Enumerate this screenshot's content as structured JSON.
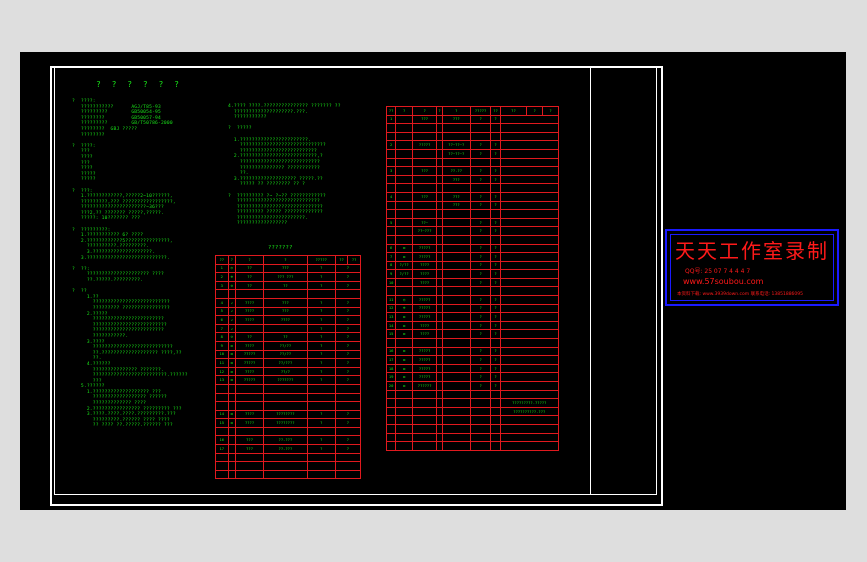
{
  "drawing": {
    "heading": "? ? ? ? ? ?",
    "col1_lines": [
      "?  ????:",
      "   ???????????      AGJ/T85-93",
      "   ?????????        GB50054-95",
      "   ????????         GB50057-94",
      "   ?????????        GB/T50786-2000",
      "   ????????  GBJ ?????",
      "   ????????",
      "",
      "?  ????:",
      "   ???",
      "   ????",
      "   ???",
      "   ????",
      "   ?????",
      "   ?????",
      "",
      "?  ???:",
      "   1.????????????,?????2~10??????,",
      "   ?????????,??? ?????????????????,",
      "   ??????????????????????~36???",
      "   ???2,?? ??????? ?????,?????.",
      "   ?????: 10??????? ???",
      "",
      "?  ?????????:",
      "   1.??????????? 6? ????",
      "   2.????????????5???????????????,",
      "     ??????????.?????????.",
      "     3.????????????????????.",
      "   3.???????????????????????????.",
      "",
      "?  ??:",
      "     ????????????????????? ????",
      "     ??.?????.?????????.",
      "",
      "?  ??",
      "     1.??",
      "       ??????????????????????????",
      "       ????????? ????????????????",
      "     2.?????",
      "       ????????????????????????",
      "       ?????????????????????????",
      "       ????????????????????????",
      "       ???????????.",
      "     3.????",
      "       ???????????????????????????",
      "       ??.??????????????????? ????,??",
      "       ??.",
      "     4.??????",
      "       ??????????????? ???????.",
      "       ?????????????????????????.??????",
      "       ???",
      "   5.??????",
      "     1.??????????????????? ???",
      "       ?????????????????? ??????",
      "       ????????????? ????",
      "     2.???????????????? ????????? ???",
      "     3.????.????.????.?????????.???",
      "       ?????????.?????? ???? ????",
      "       ?? ???? ??.?????.?????? ???"
    ],
    "col2_lines": [
      "4.???? ????.??????????????? ??????? ??",
      "  ????????????????????.???.",
      "  ???????????",
      "",
      "?  ?????",
      "",
      "  1.???????????????????????.",
      "    ?????????????????????????????",
      "    ??????????????????????????",
      "  2.??????????????????????????,?",
      "    ???????????????????????????",
      "    ??????????????? ???????????",
      "    ??.",
      "  3.??????????????????? ?????.??",
      "    ????? ?? ???????? ?? ?",
      "",
      "?  ????????? ?~ ?~?? ????????????",
      "   ????????????????????????????",
      "   ?????????????????????????????",
      "   ????????? ????? ?????????????",
      "   ???????????????????????.",
      "   ?????????????????"
    ],
    "table_a": {
      "title": "???????",
      "header": [
        "??",
        "?",
        "?",
        "?",
        "?????",
        "??",
        "??"
      ],
      "rows": [
        [
          "1",
          "◎",
          "??",
          "???",
          "?",
          "?"
        ],
        [
          "2",
          "⊕",
          "??",
          "??? ???",
          "?",
          "?"
        ],
        [
          "3",
          "⊗",
          "??",
          "??",
          "?",
          "?"
        ],
        [
          "",
          "",
          "",
          "",
          "",
          ""
        ],
        [
          "4",
          "↗",
          "????",
          "???",
          "?",
          "?"
        ],
        [
          "5",
          "↗",
          "????",
          "???",
          "?",
          "?"
        ],
        [
          "6",
          "↗",
          "????",
          "????",
          "?",
          "?"
        ],
        [
          "7",
          "↗",
          "",
          "",
          "?",
          "?"
        ],
        [
          "8",
          "⊘",
          "??",
          "??",
          "?",
          "?"
        ],
        [
          "9",
          "▬",
          "????",
          "??/??",
          "?",
          "?"
        ],
        [
          "10",
          "▬",
          "?????",
          "??/??",
          "?",
          "?"
        ],
        [
          "11",
          "▬",
          "?????",
          "??/???",
          "?",
          "?"
        ],
        [
          "12",
          "▬",
          "????",
          "??/?",
          "?",
          "?"
        ],
        [
          "13",
          "▬",
          "?????",
          "???????",
          "?",
          "?"
        ],
        [
          "",
          "",
          "",
          "",
          "",
          ""
        ],
        [
          "",
          "",
          "",
          "",
          "",
          ""
        ],
        [
          "",
          "",
          "",
          "",
          "",
          ""
        ],
        [
          "14",
          "▬",
          "????",
          "????????",
          "?",
          "?"
        ],
        [
          "15",
          "▬",
          "????",
          "????????",
          "?",
          "?"
        ],
        [
          "",
          "",
          "",
          "",
          "",
          ""
        ],
        [
          "16",
          "",
          "???",
          "??-???",
          "?",
          "?"
        ],
        [
          "17",
          "",
          "???",
          "??-???",
          "?",
          "?"
        ],
        [
          "",
          "",
          "",
          "",
          "",
          ""
        ],
        [
          "",
          "",
          "",
          "",
          "",
          ""
        ],
        [
          "",
          "",
          "",
          "",
          "",
          ""
        ]
      ]
    },
    "table_b": {
      "header": [
        "??",
        "?",
        "?",
        "?",
        "?",
        "?????",
        "??",
        "??",
        "?",
        "?"
      ],
      "rows": [
        [
          "1",
          "",
          "???",
          "",
          "???",
          "?",
          "?",
          ""
        ],
        [
          "",
          "",
          "",
          "",
          "",
          "",
          "",
          ""
        ],
        [
          "",
          "",
          "",
          "",
          "",
          "",
          "",
          ""
        ],
        [
          "2",
          "",
          "?????",
          "",
          "??~??~?",
          "?",
          "?",
          ""
        ],
        [
          "",
          "",
          "",
          "",
          "??~??~?",
          "?",
          "?",
          ""
        ],
        [
          "",
          "",
          "",
          "",
          "",
          "",
          "",
          ""
        ],
        [
          "3",
          "",
          "???",
          "",
          "??.??",
          "?",
          "?",
          ""
        ],
        [
          "",
          "",
          "",
          "",
          "???",
          "?",
          "?",
          ""
        ],
        [
          "",
          "",
          "",
          "",
          "",
          "",
          "",
          ""
        ],
        [
          "4",
          "",
          "???",
          "",
          "???",
          "?",
          "?",
          ""
        ],
        [
          "",
          "",
          "",
          "",
          "???",
          "?",
          "?",
          ""
        ],
        [
          "",
          "",
          "",
          "",
          "",
          "",
          "",
          ""
        ],
        [
          "5",
          "",
          "??~",
          "",
          "",
          "?",
          "?",
          ""
        ],
        [
          "",
          "",
          "??~???",
          "",
          "",
          "?",
          "?",
          ""
        ],
        [
          "",
          "",
          "",
          "",
          "",
          "",
          "",
          ""
        ],
        [
          "6",
          "▬",
          "?????",
          "",
          "",
          "?",
          "?",
          ""
        ],
        [
          "7",
          "▬",
          "?????",
          "",
          "",
          "?",
          "?",
          ""
        ],
        [
          "8",
          "?/??",
          "????",
          "",
          "",
          "?",
          "?",
          ""
        ],
        [
          "9",
          "?/??",
          "????",
          "",
          "",
          "?",
          "?",
          ""
        ],
        [
          "10",
          "",
          "????",
          "",
          "",
          "?",
          "?",
          ""
        ],
        [
          "",
          "",
          "",
          "",
          "",
          "",
          "",
          ""
        ],
        [
          "11",
          "◎",
          "?????",
          "",
          "",
          "?",
          "?",
          ""
        ],
        [
          "12",
          "⊕",
          "?????",
          "",
          "",
          "?",
          "?",
          ""
        ],
        [
          "13",
          "▬",
          "?????",
          "",
          "",
          "?",
          "?",
          ""
        ],
        [
          "14",
          "▬",
          "????",
          "",
          "",
          "?",
          "?",
          ""
        ],
        [
          "15",
          "▬",
          "????",
          "",
          "",
          "?",
          "?",
          ""
        ],
        [
          "",
          "",
          "",
          "",
          "",
          "",
          "",
          ""
        ],
        [
          "16",
          "▬",
          "?????",
          "",
          "",
          "?",
          "?",
          ""
        ],
        [
          "17",
          "▬",
          "?????",
          "",
          "",
          "?",
          "?",
          ""
        ],
        [
          "18",
          "▬",
          "?????",
          "",
          "",
          "?",
          "?",
          ""
        ],
        [
          "19",
          "▬",
          "?????",
          "",
          "",
          "?",
          "?",
          ""
        ],
        [
          "20",
          "▬",
          "??????",
          "",
          "",
          "?",
          "?",
          ""
        ],
        [
          "",
          "",
          "",
          "",
          "",
          "",
          "",
          ""
        ],
        [
          "",
          "",
          "",
          "",
          "",
          "",
          "",
          "?????????.?????"
        ],
        [
          "",
          "",
          "",
          "",
          "",
          "",
          "",
          "??????????.???"
        ],
        [
          "",
          "",
          "",
          "",
          "",
          "",
          "",
          ""
        ],
        [
          "",
          "",
          "",
          "",
          "",
          "",
          "",
          ""
        ],
        [
          "",
          "",
          "",
          "",
          "",
          "",
          "",
          ""
        ],
        [
          "",
          "",
          "",
          "",
          "",
          "",
          "",
          ""
        ]
      ]
    }
  },
  "watermark": {
    "title": "天天工作室录制",
    "qq": "QQ号: 25 07 7 4 4 4 7",
    "url": "www.57soubou.com",
    "footer": "本资料下载: www.3939down.com  联系电话: 13851886095"
  },
  "colors": {
    "canvas": "#000000",
    "text_green": "#19e619",
    "table_red": "#e0191e",
    "frame_white": "#ffffff",
    "watermark_blue": "#1a1aff",
    "watermark_red": "#ff1a1a",
    "background": "#dedede"
  }
}
